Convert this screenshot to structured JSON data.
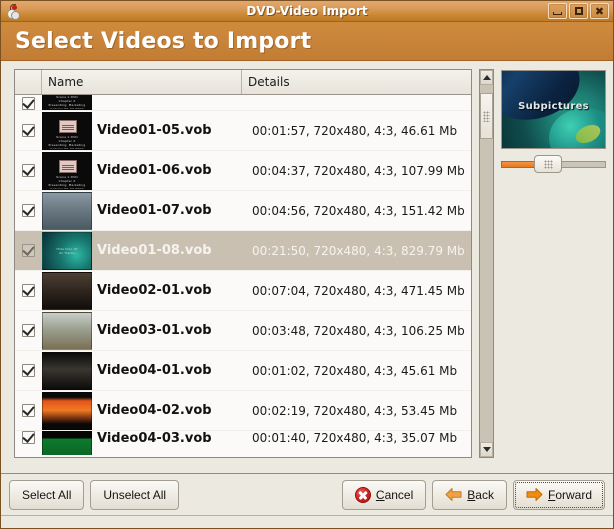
{
  "window": {
    "title": "DVD-Video Import",
    "app_icon": "dvd-disc-icon",
    "controls": {
      "minimize": "minimize-icon",
      "maximize": "maximize-icon",
      "close": "close-icon"
    }
  },
  "header": {
    "title": "Select Videos to Import"
  },
  "list": {
    "columns": {
      "check": "",
      "name": "Name",
      "details": "Details"
    },
    "rows": [
      {
        "name": "",
        "details": "",
        "checked": true,
        "selected": false,
        "partial": "top",
        "thumb": "menu-card-dark"
      },
      {
        "name": "Video01-05.vob",
        "details": "00:01:57, 720x480, 4:3, 46.61 Mb",
        "checked": true,
        "selected": false,
        "thumb": "menu-card-dark"
      },
      {
        "name": "Video01-06.vob",
        "details": "00:04:37, 720x480, 4:3, 107.99 Mb",
        "checked": true,
        "selected": false,
        "thumb": "menu-card-dark"
      },
      {
        "name": "Video01-07.vob",
        "details": "00:04:56, 720x480, 4:3, 151.42 Mb",
        "checked": true,
        "selected": false,
        "thumb": "person-scene"
      },
      {
        "name": "Video01-08.vob",
        "details": "00:21:50, 720x480, 4:3, 829.79 Mb",
        "checked": true,
        "selected": true,
        "thumb": "teal-swirl"
      },
      {
        "name": "Video02-01.vob",
        "details": "00:07:04, 720x480, 4:3, 471.45 Mb",
        "checked": true,
        "selected": false,
        "thumb": "night-city"
      },
      {
        "name": "Video03-01.vob",
        "details": "00:03:48, 720x480, 4:3, 106.25 Mb",
        "checked": true,
        "selected": false,
        "thumb": "street-building"
      },
      {
        "name": "Video04-01.vob",
        "details": "00:01:02, 720x480, 4:3, 45.61 Mb",
        "checked": true,
        "selected": false,
        "thumb": "dark-interior"
      },
      {
        "name": "Video04-02.vob",
        "details": "00:02:19, 720x480, 4:3, 53.45 Mb",
        "checked": true,
        "selected": false,
        "thumb": "orange-sunset"
      },
      {
        "name": "Video04-03.vob",
        "details": "00:01:40, 720x480, 4:3, 35.07 Mb",
        "checked": true,
        "selected": false,
        "partial": "bottom",
        "thumb": "green-title"
      }
    ]
  },
  "scrollbar": {
    "up": "scroll-up-arrow",
    "down": "scroll-down-arrow"
  },
  "preview": {
    "caption": "Subpictures",
    "slider_value": 45
  },
  "actions": {
    "select_all": "Select All",
    "unselect_all": "Unselect All",
    "cancel": "Cancel",
    "cancel_mnemonic": "C",
    "cancel_rest": "ancel",
    "back": "Back",
    "back_mnemonic": "B",
    "back_rest": "ack",
    "forward": "Forward",
    "forward_mnemonic": "F",
    "forward_rest": "orward"
  },
  "colors": {
    "title_orange": "#c8833a",
    "header_orange": "#cf8b3c",
    "background": "#ece9e1",
    "selection": "#c9c0b2",
    "accent_arrow": "#ef8b1c",
    "cancel_red": "#d01f1f"
  }
}
